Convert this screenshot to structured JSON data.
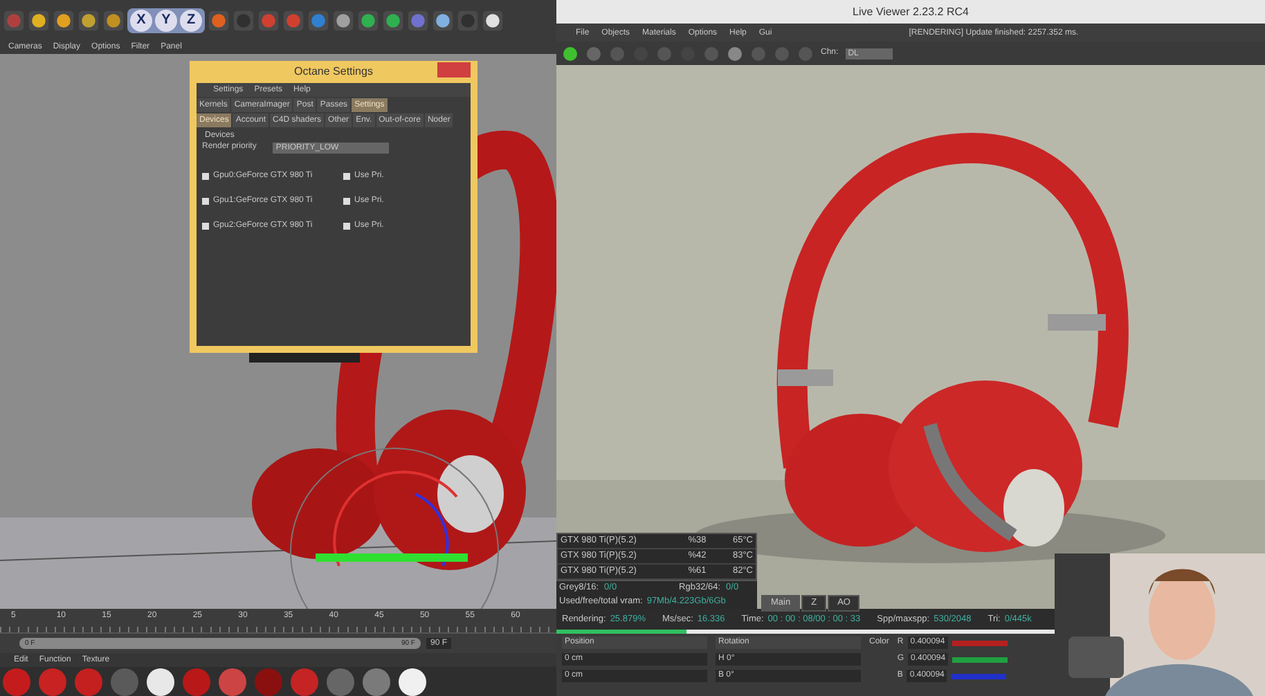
{
  "editor": {
    "axes": [
      "X",
      "Y",
      "Z"
    ],
    "view_menu": [
      "Cameras",
      "Display",
      "Options",
      "Filter",
      "Panel"
    ],
    "timeline": {
      "ticks": [
        "5",
        "10",
        "15",
        "20",
        "25",
        "30",
        "35",
        "40",
        "45",
        "50",
        "55",
        "60"
      ],
      "start": "0 F",
      "end": "90 F",
      "level": 1,
      "end_field": "90 F"
    },
    "material_menu": [
      "Edit",
      "Function",
      "Texture"
    ],
    "materials": [
      {
        "color": "#c41c1c"
      },
      {
        "color": "#c82222"
      },
      {
        "color": "#c42020"
      },
      {
        "color": "#5a5a5a"
      },
      {
        "color": "#e8e8e8"
      },
      {
        "color": "#b81818"
      },
      {
        "color": "#cc4444"
      },
      {
        "color": "#8a1010"
      },
      {
        "color": "#c42424"
      },
      {
        "color": "#666666"
      },
      {
        "color": "#7a7a7a"
      },
      {
        "color": "#f0f0f0"
      }
    ]
  },
  "octane_settings": {
    "title": "Octane Settings",
    "menu": [
      "Settings",
      "Presets",
      "Help"
    ],
    "tabs": [
      {
        "label": "Kernels",
        "selected": false
      },
      {
        "label": "CameraImager",
        "selected": false
      },
      {
        "label": "Post",
        "selected": false
      },
      {
        "label": "Passes",
        "selected": false
      },
      {
        "label": "Settings",
        "selected": true
      }
    ],
    "subtabs": [
      {
        "label": "Devices",
        "selected": true
      },
      {
        "label": "Account",
        "selected": false
      },
      {
        "label": "C4D shaders",
        "selected": false
      },
      {
        "label": "Other",
        "selected": false
      },
      {
        "label": "Env.",
        "selected": false
      },
      {
        "label": "Out-of-core",
        "selected": false
      },
      {
        "label": "Noder",
        "selected": false
      }
    ],
    "section": "Devices",
    "priority_label": "Render priority",
    "priority_value": "PRIORITY_LOW",
    "devices": [
      {
        "name": "Gpu0:GeForce GTX 980 Ti",
        "checked": true,
        "use_priority_label": "Use Pri.",
        "use_priority": true
      },
      {
        "name": "Gpu1:GeForce GTX 980 Ti",
        "checked": true,
        "use_priority_label": "Use Pri.",
        "use_priority": true
      },
      {
        "name": "Gpu2:GeForce GTX 980 Ti",
        "checked": true,
        "use_priority_label": "Use Pri.",
        "use_priority": true
      }
    ]
  },
  "live_viewer": {
    "title": "Live Viewer 2.23.2 RC4",
    "menu": [
      "File",
      "Objects",
      "Materials",
      "Options",
      "Help",
      "Gui"
    ],
    "status": "[RENDERING] Update finished: 2257.352 ms.",
    "channel_label": "Chn:",
    "channel_value": "DL",
    "gpus": [
      {
        "name": "GTX 980 Ti(P)(5.2)",
        "load": "%38",
        "temp": "65°C"
      },
      {
        "name": "GTX 980 Ti(P)(5.2)",
        "load": "%42",
        "temp": "83°C"
      },
      {
        "name": "GTX 980 Ti(P)(5.2)",
        "load": "%61",
        "temp": "82°C"
      }
    ],
    "grey_label": "Grey8/16:",
    "grey_value": "0/0",
    "rgb_label": "Rgb32/64:",
    "rgb_value": "0/0",
    "vram_label": "Used/free/total vram:",
    "vram_value": "97Mb/4.223Gb/6Gb",
    "view_buttons": [
      {
        "label": "Main",
        "selected": true
      },
      {
        "label": "Z",
        "selected": false
      },
      {
        "label": "AO",
        "selected": false
      }
    ],
    "stats": [
      {
        "label": "Rendering:",
        "value": "25.879%"
      },
      {
        "label": "Ms/sec:",
        "value": "16.336"
      },
      {
        "label": "Time:",
        "value": "00 : 00 : 08/00 : 00 : 33"
      },
      {
        "label": "Spp/maxspp:",
        "value": "530/2048"
      },
      {
        "label": "Tri:",
        "value": "0/445k"
      }
    ],
    "progress": {
      "level": 0.26
    }
  },
  "attributes": {
    "columns": [
      {
        "header": "Position",
        "fields": [
          "0 cm",
          "0 cm"
        ]
      },
      {
        "header": "Rotation",
        "fields": [
          "H 0°",
          "B 0°"
        ]
      }
    ],
    "color_label": "Color",
    "channels": [
      {
        "name": "R",
        "value": "0.400094",
        "color": "#b42020"
      },
      {
        "name": "G",
        "value": "0.400094",
        "color": "#20a040"
      },
      {
        "name": "B",
        "value": "0.400094",
        "color": "#2030c8"
      }
    ]
  }
}
